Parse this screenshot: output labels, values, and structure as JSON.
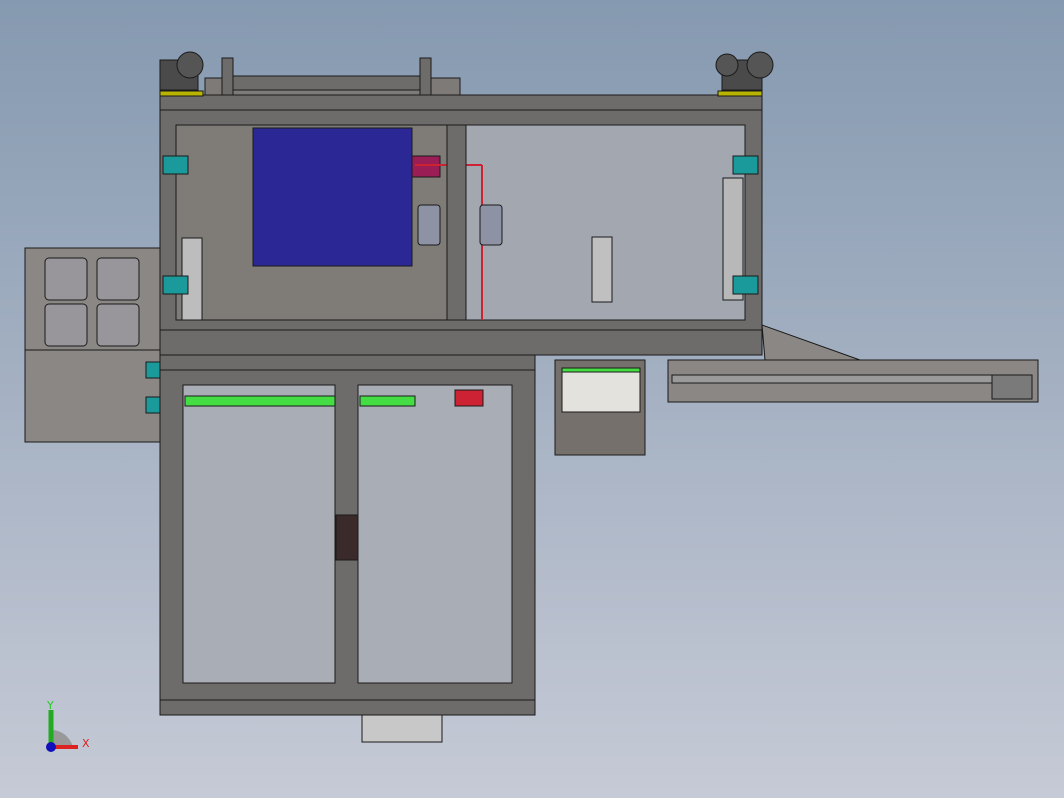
{
  "viewport": {
    "triad": {
      "x_label": "X",
      "y_label": "Y"
    }
  },
  "colors": {
    "frame": "#6e6c6a",
    "panel_dark": "#7f7b77",
    "panel_glass": "#a3a8b0",
    "screen": "#2b2896",
    "hinge": "#1a9a9a",
    "pad": "#b8b400",
    "accent_red": "#cc2233",
    "accent_green": "#44dd44"
  }
}
